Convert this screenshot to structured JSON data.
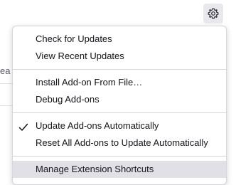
{
  "background": {
    "partial_text": "ea"
  },
  "toolbar": {
    "gear_icon": "gear-icon"
  },
  "menu": {
    "group1": {
      "check_updates": "Check for Updates",
      "view_recent": "View Recent Updates"
    },
    "group2": {
      "install_from_file": "Install Add-on From File…",
      "debug": "Debug Add-ons"
    },
    "group3": {
      "update_automatically": "Update Add-ons Automatically",
      "update_automatically_checked": true,
      "reset_all": "Reset All Add-ons to Update Automatically"
    },
    "group4": {
      "manage_shortcuts": "Manage Extension Shortcuts",
      "manage_shortcuts_hovered": true
    }
  },
  "colors": {
    "menu_border": "#d7d7db",
    "hover_background": "#e0e0e6",
    "text": "#15141a"
  }
}
